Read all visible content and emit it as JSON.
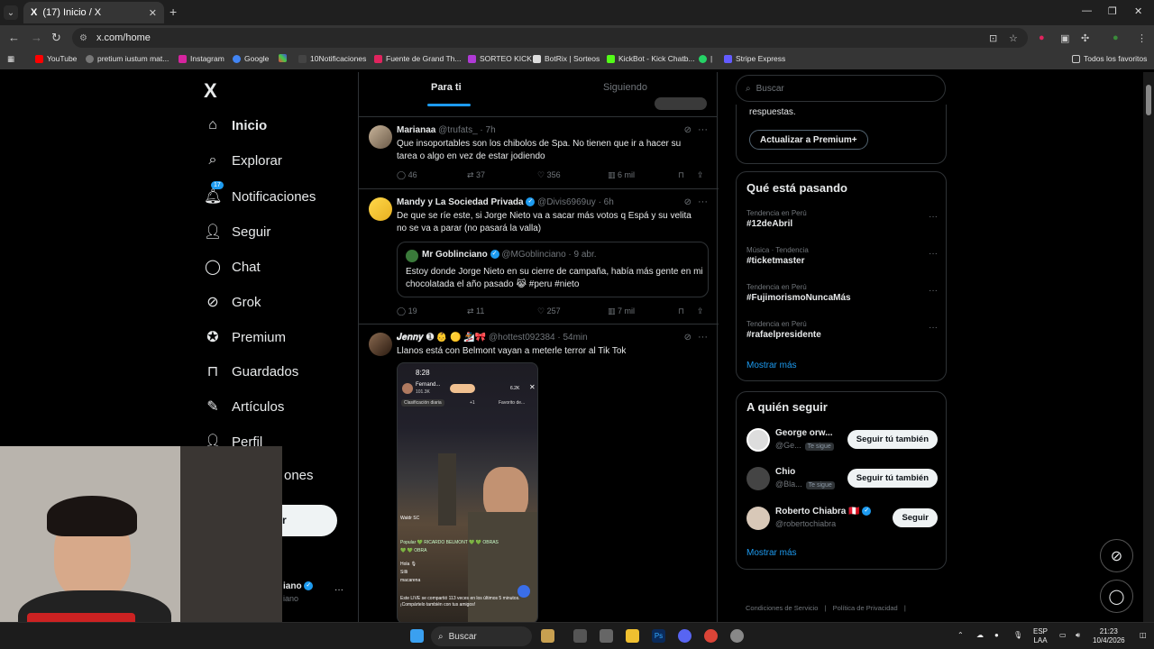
{
  "browser": {
    "tab_title": "(17) Inicio / X",
    "tab_icon": "X",
    "new_tab": "+",
    "url": "x.com/home",
    "bookmarks": [
      "YouTube",
      "pretium iustum mat...",
      "Instagram",
      "Google",
      "10Notificaciones",
      "Fuente de Grand Th...",
      "SORTEO KICK",
      "BotRix | Sorteos",
      "KickBot - Kick Chatb...",
      "|",
      "Stripe Express"
    ],
    "other_bookmarks": "Todos los favoritos"
  },
  "nav": {
    "logo": "X",
    "items": [
      {
        "label": "Inicio",
        "icon": "home-icon"
      },
      {
        "label": "Explorar",
        "icon": "search-icon"
      },
      {
        "label": "Notificaciones",
        "icon": "bell-icon"
      },
      {
        "label": "Seguir",
        "icon": "follow-icon"
      },
      {
        "label": "Chat",
        "icon": "chat-icon"
      },
      {
        "label": "Grok",
        "icon": "grok-icon"
      },
      {
        "label": "Premium",
        "icon": "premium-icon"
      },
      {
        "label": "Guardados",
        "icon": "bookmark-icon"
      },
      {
        "label": "Artículos",
        "icon": "articles-icon"
      },
      {
        "label": "Perfil",
        "icon": "profile-icon"
      },
      {
        "label": "ones",
        "icon": "more-icon"
      }
    ],
    "notif_badge": "17",
    "post_button": "r",
    "user_name": "iano",
    "user_handle": "iano",
    "user_more": "···"
  },
  "timeline": {
    "tabs": [
      "Para ti",
      "Siguiendo"
    ],
    "tweets": [
      {
        "name": "Marianaa",
        "handle": "@trufats_ · 7h",
        "text": "Que insoportables son los chibolos de Spa. No tienen que ir a hacer su tarea o algo en vez de estar jodiendo",
        "replies": "46",
        "retweets": "37",
        "likes": "356",
        "views": "6 mil"
      },
      {
        "name": "Mandy y La Sociedad Privada",
        "handle": "@Divis6969uy · 6h",
        "text": "De que se ríe este, si Jorge Nieto va a sacar más votos q Espá y su velita no se va a parar (no pasará la valla)",
        "replies": "19",
        "retweets": "11",
        "likes": "257",
        "views": "7 mil",
        "quote": {
          "name": "Mr Goblinciano",
          "handle": "@MGoblinciano · 9 abr.",
          "text": "Estoy donde Jorge Nieto en su cierre de campaña, había más gente en mi chocolatada el año pasado 😹 #peru #nieto"
        }
      },
      {
        "name": "𝑱𝒆𝒏𝒏𝒚 ➊ 👶 🟡 🏂🎀",
        "handle": "@hottest092384 · 54min",
        "text": "Llanos está con Belmont vayan a meterle terror al Tik Tok",
        "media": {
          "time": "8:28",
          "streamer": "Fernand...",
          "viewers": "101.3K",
          "count": "6.2K",
          "rank": "Clasificación diaria",
          "plus": "+1",
          "favs": "Favorito de...",
          "chat": [
            "Waldr SC",
            "Popular 💚 RICARDO BELMONT 💚 💚 OBRAS 💚 💚 OBRA",
            "Hola 🎙",
            "Sílli",
            "macarena"
          ],
          "footer": "Este LIVE se compartió 113 veces en los últimos 5 minutos. ¡Compártelo también con tus amigos!"
        }
      }
    ]
  },
  "sidebar": {
    "search_placeholder": "Buscar",
    "premium_text": "respuestas.",
    "premium_button": "Actualizar a Premium+",
    "trends_title": "Qué está pasando",
    "trends": [
      {
        "context": "Tendencia en Perú",
        "tag": "#12deAbril"
      },
      {
        "context": "Música · Tendencia",
        "tag": "#ticketmaster"
      },
      {
        "context": "Tendencia en Perú",
        "tag": "#FujimorismoNuncaMás"
      },
      {
        "context": "Tendencia en Perú",
        "tag": "#rafaelpresidente"
      }
    ],
    "show_more": "Mostrar más",
    "follow_title": "A quién seguir",
    "follows": [
      {
        "name": "George orw...",
        "handle": "@Ge...",
        "badge": "Te sigue",
        "button": "Seguir tú también"
      },
      {
        "name": "Chio",
        "handle": "@Bla...",
        "badge": "Te sigue",
        "button": "Seguir tú también"
      },
      {
        "name": "Roberto Chiabra 🇵🇪",
        "handle": "@robertochiabra",
        "badge": "",
        "button": "Seguir"
      }
    ],
    "show_more_2": "Mostrar más",
    "footer_links": [
      "Condiciones de Servicio",
      "|",
      "Política de Privacidad",
      "|"
    ]
  },
  "taskbar": {
    "search": "Buscar",
    "lang": "ESP",
    "lang2": "LAA",
    "time": "21:23",
    "date": "10/4/2026"
  },
  "colors": {
    "accent": "#1d9bf0",
    "bg": "#000000",
    "border": "#2f3336",
    "muted": "#71767b"
  }
}
